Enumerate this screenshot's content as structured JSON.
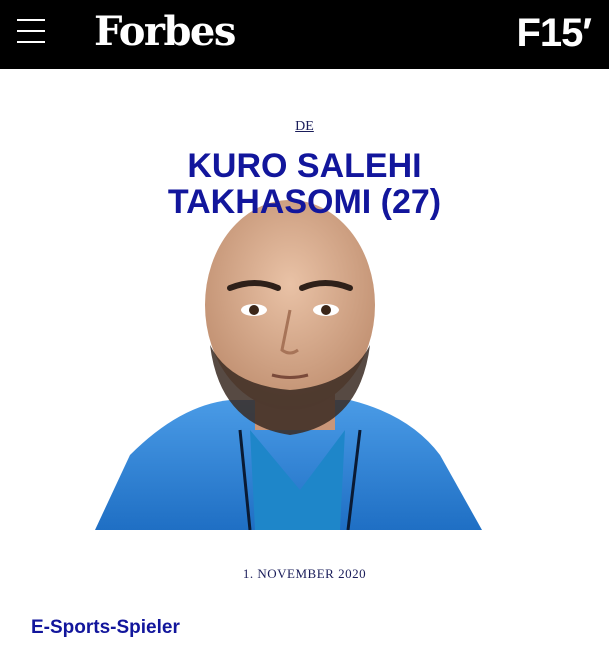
{
  "header": {
    "logo": "Forbes",
    "section_logo": "F15′"
  },
  "article": {
    "language_link": "DE",
    "name_line1": "KURO SALEHI",
    "name_line2": "TAKHASOMI (27)",
    "date": "1. NOVEMBER 2020",
    "occupation": "E-Sports-Spieler"
  },
  "colors": {
    "topbar": "#000000",
    "title_blue": "#12169c",
    "jacket_blue": "#2f7fd0"
  }
}
